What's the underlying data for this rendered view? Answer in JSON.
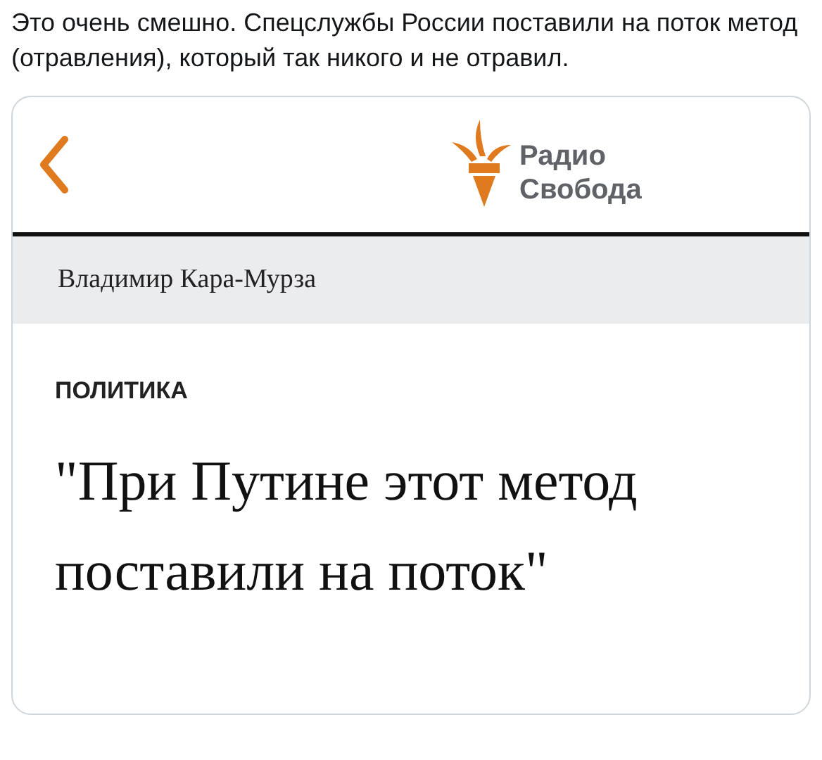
{
  "tweet": {
    "text": "Это очень смешно. Спецслужбы России поставили на поток метод (отравления), который так никого и не отравил."
  },
  "card": {
    "logo": [
      "Радио",
      "Свобода"
    ],
    "author": "Владимир Кара-Мурза",
    "category": "ПОЛИТИКА",
    "headline": "\"При Путине этот метод поставили на поток\""
  }
}
